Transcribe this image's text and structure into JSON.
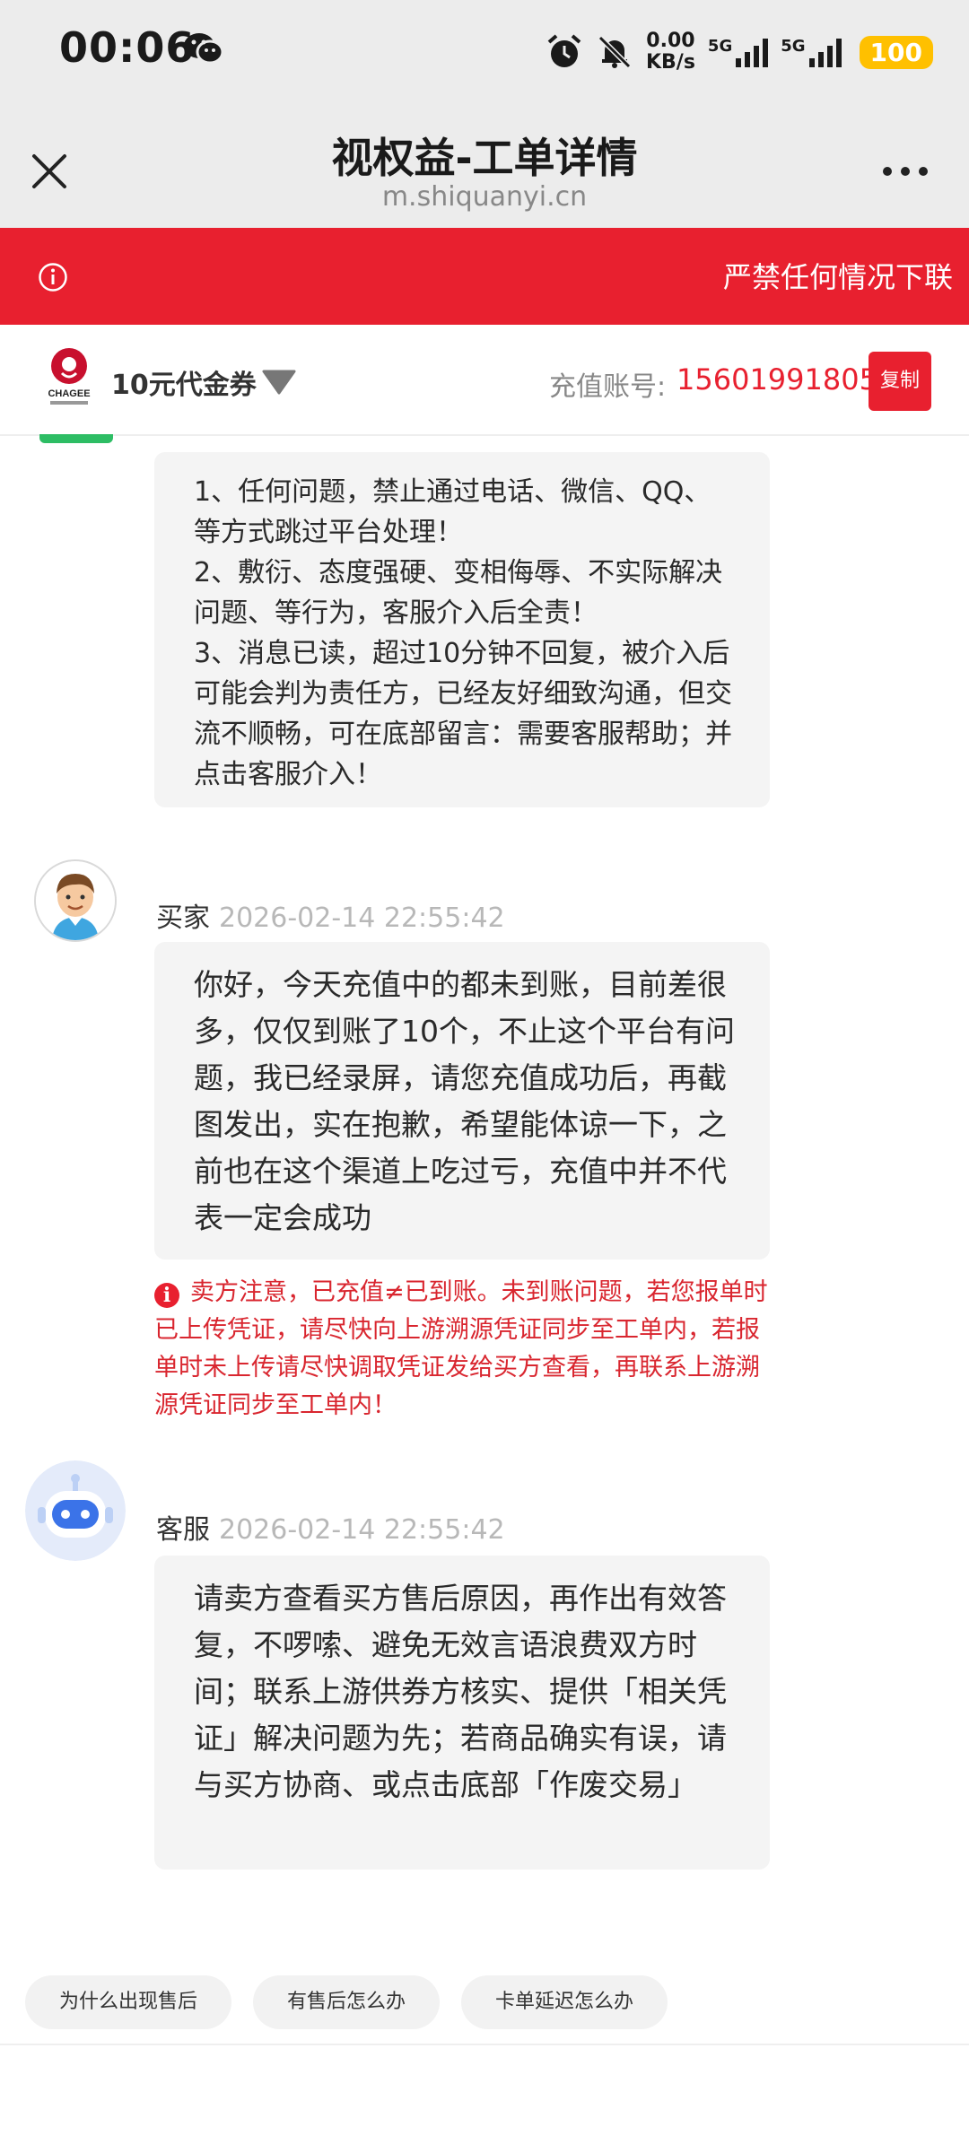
{
  "status_bar": {
    "time": "00:06",
    "speed_value": "0.00",
    "speed_unit": "KB/s",
    "network_1": "5G",
    "network_2": "5G",
    "battery": "100"
  },
  "header": {
    "title": "视权益-工单详情",
    "domain": "m.shiquanyi.cn"
  },
  "notice": {
    "text": "严禁任何情况下联"
  },
  "product": {
    "name": "10元代金券",
    "account_label": "充值账号:",
    "account_value": "15601991805",
    "copy_label": "复制"
  },
  "messages": {
    "rules": [
      "1、任何问题，禁止通过电话、微信、QQ、等方式跳过平台处理！",
      "2、敷衍、态度强硬、变相侮辱、不实际解决问题、等行为，客服介入后全责！",
      "3、消息已读，超过10分钟不回复，被介入后可能会判为责任方，已经友好细致沟通，但交流不顺畅，可在底部留言：需要客服帮助；并点击客服介入！"
    ],
    "buyer": {
      "name": "买家",
      "time": "2026-02-14 22:55:42",
      "text": "你好，今天充值中的都未到账，目前差很多，仅仅到账了10个，不止这个平台有问题，我已经录屏，请您充值成功后，再截图发出，实在抱歉，希望能体谅一下，之前也在这个渠道上吃过亏，充值中并不代表一定会成功"
    },
    "warning": "卖方注意，已充值≠已到账。未到账问题，若您报单时已上传凭证，请尽快向上游溯源凭证同步至工单内，若报单时未上传请尽快调取凭证发给买方查看，再联系上游溯源凭证同步至工单内！",
    "service": {
      "name": "客服",
      "time": "2026-02-14 22:55:42",
      "text": "请卖方查看买方售后原因，再作出有效答复，不啰嗦、避免无效言语浪费双方时间；联系上游供券方核实、提供「相关凭证」解决问题为先；若商品确实有误，请与买方协商、或点击底部「作废交易」"
    }
  },
  "quick_actions": [
    "为什么出现售后",
    "有售后怎么办",
    "卡单延迟怎么办"
  ],
  "colors": {
    "accent_red": "#e8202f",
    "header_gray": "#ececec",
    "bubble_gray": "#f4f4f4",
    "battery_yellow": "#ffc000",
    "online_green": "#2dbd64"
  },
  "icons": [
    "wechat-icon",
    "alarm-icon",
    "mute-bell-icon",
    "close-icon",
    "more-icon",
    "info-icon",
    "chagee-logo",
    "dropdown-arrow-icon",
    "buyer-avatar",
    "robot-avatar",
    "warning-icon"
  ]
}
